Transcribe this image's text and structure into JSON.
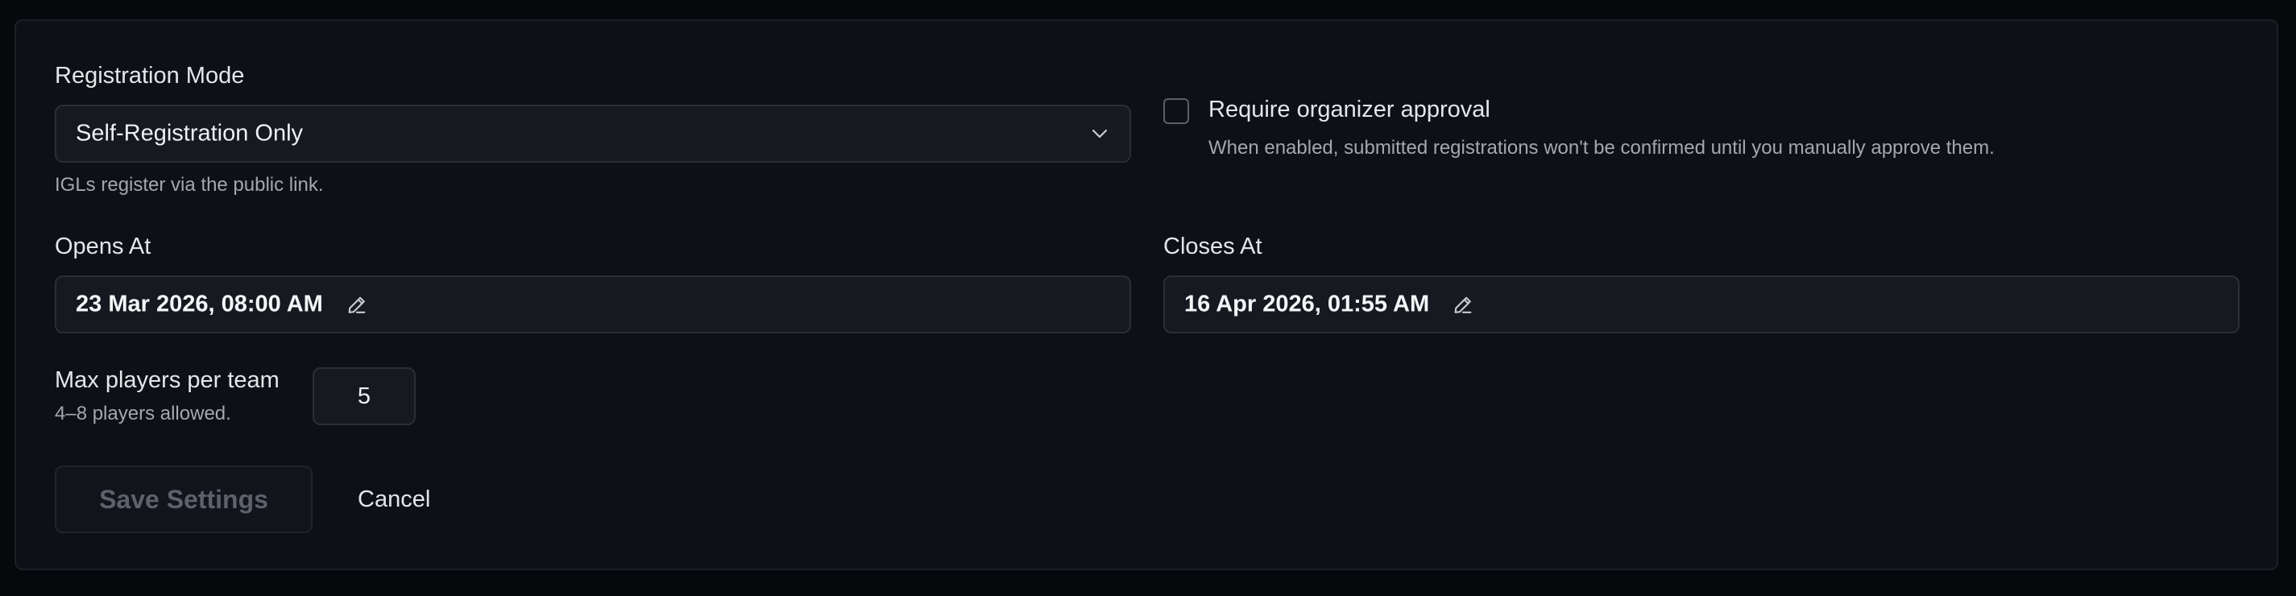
{
  "registration": {
    "label": "Registration Mode",
    "selected": "Self-Registration Only",
    "helper": "IGLs register via the public link."
  },
  "approval": {
    "label": "Require organizer approval",
    "description": "When enabled, submitted registrations won't be confirmed until you manually approve them.",
    "checked": false
  },
  "opens": {
    "label": "Opens At",
    "value": "23 Mar 2026, 08:00 AM"
  },
  "closes": {
    "label": "Closes At",
    "value": "16 Apr 2026, 01:55 AM"
  },
  "max_players": {
    "label": "Max players per team",
    "helper": "4–8 players allowed.",
    "value": "5"
  },
  "actions": {
    "save_label": "Save Settings",
    "cancel_label": "Cancel"
  },
  "icons": {
    "select": "chevron-down-icon",
    "edit": "pencil-icon"
  }
}
